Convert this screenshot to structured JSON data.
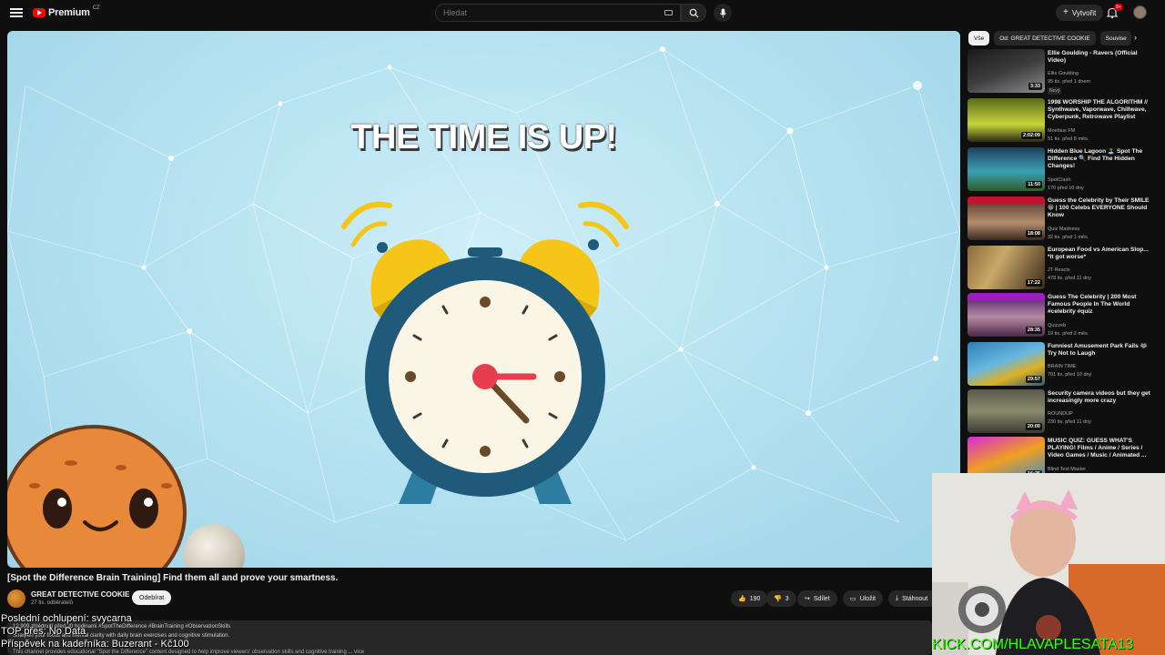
{
  "header": {
    "logo_text": "Premium",
    "logo_country": "CZ",
    "search_placeholder": "Hledat",
    "create_label": "Vytvořit",
    "notifications_count": "9+"
  },
  "video": {
    "overlay_title": "THE TIME IS UP!",
    "title": "[Spot the Difference Brain Training] Find them all and prove your smartness.",
    "channel": "GREAT DETECTIVE COOKIE",
    "subscribers": "27 tis. odběratelů",
    "subscribe_label": "Odebírat",
    "likes": "190",
    "dislikes": "3",
    "share_label": "Sdílet",
    "save_label": "Uložit",
    "download_label": "Stáhnout",
    "desc_meta": "12 909 zhlédnutí  před 20 hodinami  #SpotTheDifference #BrainTraining #ObservationSkills",
    "desc_line": "Sharpen your focus and mental clarity with daily brain exercises and cognitive stimulation.",
    "desc_line3": "This channel provides educational \"Spot the Difference\" content designed to help improve viewers' observation skills and cognitive training ... více"
  },
  "overlay": {
    "line1": "Poslední ochlupení: svycarna",
    "line2": "TOP přes: No Data",
    "line3": "Příspěvek na kadeřníka: Buzerant - Kč100",
    "kick": "KICK.COM/HLAVAPLESATA13"
  },
  "sidebar": {
    "chips": [
      "Vše",
      "Od: GREAT DETECTIVE COOKIE",
      "Souvise"
    ],
    "items": [
      {
        "title": "Ellie Goulding - Ravers (Official Video)",
        "channel": "Ellie Goulding",
        "meta": "95 tis.  před 1 dnem",
        "badge": "Nový",
        "duration": "3:33"
      },
      {
        "title": "1998 WORSHIP THE ALGORITHM // Synthwave, Vaporwave, Chillwave, Cyberpunk, Retrowave Playlist",
        "channel": "Moebius FM",
        "meta": "51 tis.  před 8 měs.",
        "duration": "2:02:09"
      },
      {
        "title": "Hidden Blue Lagoon 🏝️ Spot The Difference 🔍 Find The Hidden Changes!",
        "channel": "SpotClash",
        "meta": "170  před 10 dny",
        "duration": "11:50"
      },
      {
        "title": "Guess the Celebrity by Their SMILE 😁 | 100 Celebs EVERYONE Should Know",
        "channel": "Quiz Madness",
        "meta": "32 tis.  před 1 měs.",
        "duration": "18:08"
      },
      {
        "title": "European Food vs American Slop... *it got worse*",
        "channel": "JT Reacts",
        "meta": "478 tis.  před 11 dny",
        "duration": "17:22"
      },
      {
        "title": "Guess The Celebrity | 200 Most Famous People In The World #celebrity #quiz",
        "channel": "Quizzeb",
        "meta": "19 tis.  před 2 měs.",
        "duration": "28:35"
      },
      {
        "title": "Funniest Amusement Park Fails 😂 Try Not to Laugh",
        "channel": "BRAIN TIME",
        "meta": "701 tis.  před 10 dny",
        "duration": "29:57"
      },
      {
        "title": "Security camera videos but they get increasingly more crazy",
        "channel": "ROUNDUP",
        "meta": "230 tis.  před 11 dny",
        "duration": "20:00"
      },
      {
        "title": "MUSIC QUIZ: GUESS WHAT'S PLAYING! Films / Anime / Series / Video Games / Music / Animated ...",
        "channel": "Blind Test Master",
        "meta": "",
        "duration": "16:25"
      }
    ]
  },
  "colors": {
    "background": "#0f0f0f",
    "accent_red": "#ff0000",
    "kick_green": "#39ff14"
  }
}
